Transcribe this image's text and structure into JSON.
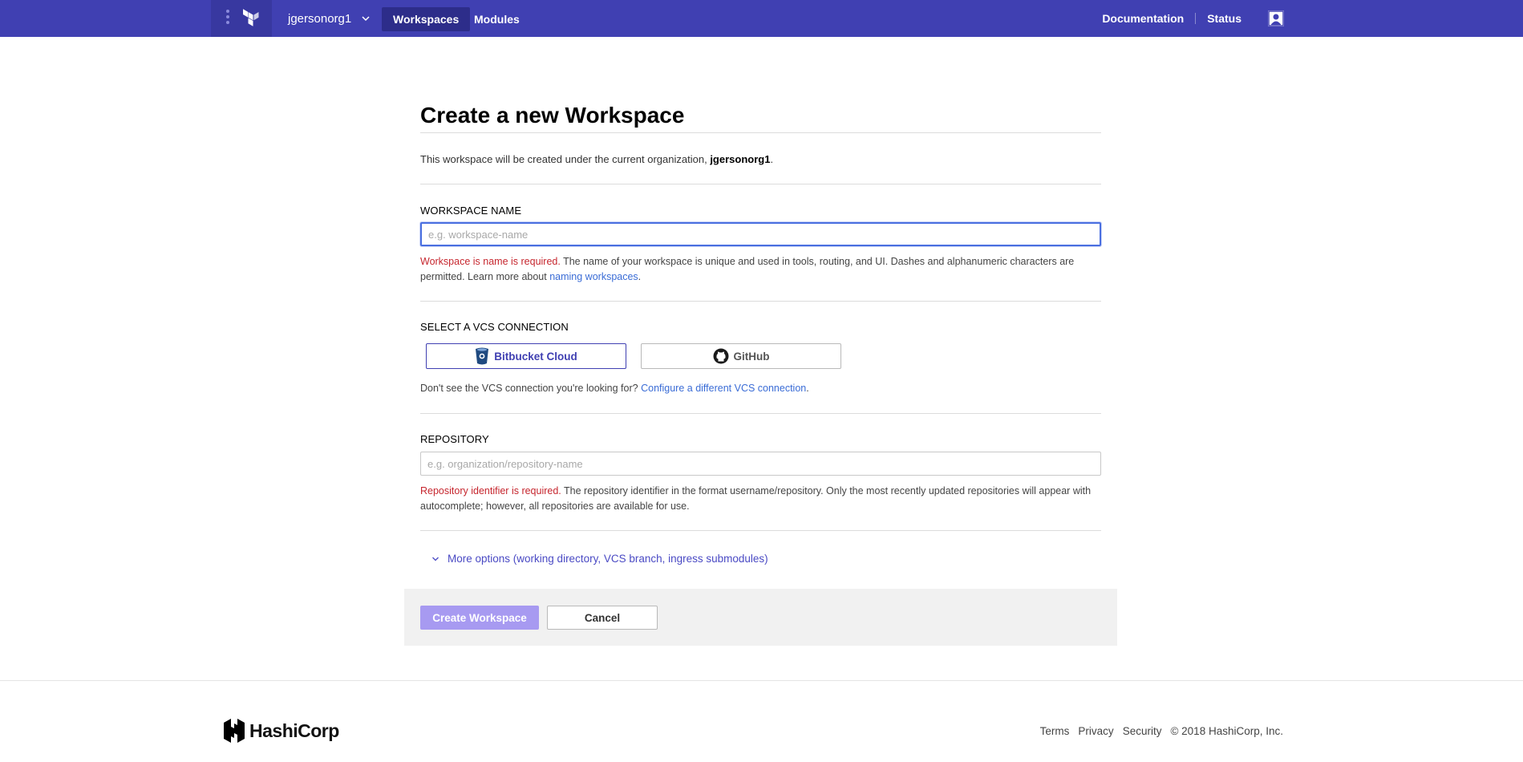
{
  "nav": {
    "org_name": "jgersonorg1",
    "links": [
      {
        "label": "Workspaces",
        "active": true
      },
      {
        "label": "Modules",
        "active": false
      }
    ],
    "right_links": [
      "Documentation",
      "Status"
    ],
    "bg_color": "#4040b2"
  },
  "page": {
    "title": "Create a new Workspace",
    "intro_prefix": "This workspace will be created under the current organization,",
    "intro_org": "jgersonorg1",
    "intro_suffix": "."
  },
  "workspace_name": {
    "label": "WORKSPACE NAME",
    "value": "",
    "placeholder": "e.g. workspace-name",
    "error": "Workspace is name is required.",
    "help": " The name of your workspace is unique and used in tools, routing, and UI. Dashes and alphanumeric characters are permitted. Learn more about ",
    "help_link": "naming workspaces",
    "help_end": "."
  },
  "vcs": {
    "label": "SELECT A VCS CONNECTION",
    "options": [
      {
        "label": "Bitbucket Cloud",
        "icon": "bitbucket-icon",
        "selected": true
      },
      {
        "label": "GitHub",
        "icon": "github-icon",
        "selected": false
      }
    ],
    "help": "Don't see the VCS connection you're looking for?",
    "help_link": "Configure a different VCS connection",
    "help_end": "."
  },
  "repository": {
    "label": "REPOSITORY",
    "value": "",
    "placeholder": "e.g. organization/repository-name",
    "error": "Repository identifier is required.",
    "help": " The repository identifier in the format username/repository. Only the most recently updated repositories will appear with autocomplete; however, all repositories are available for use."
  },
  "more_options": {
    "label": "More options (working directory, VCS branch, ingress submodules)"
  },
  "actions": {
    "create_label": "Create Workspace",
    "cancel_label": "Cancel"
  },
  "footer": {
    "brand": "HashiCorp",
    "links": [
      "Terms",
      "Privacy",
      "Security",
      "© 2018 HashiCorp, Inc."
    ]
  }
}
